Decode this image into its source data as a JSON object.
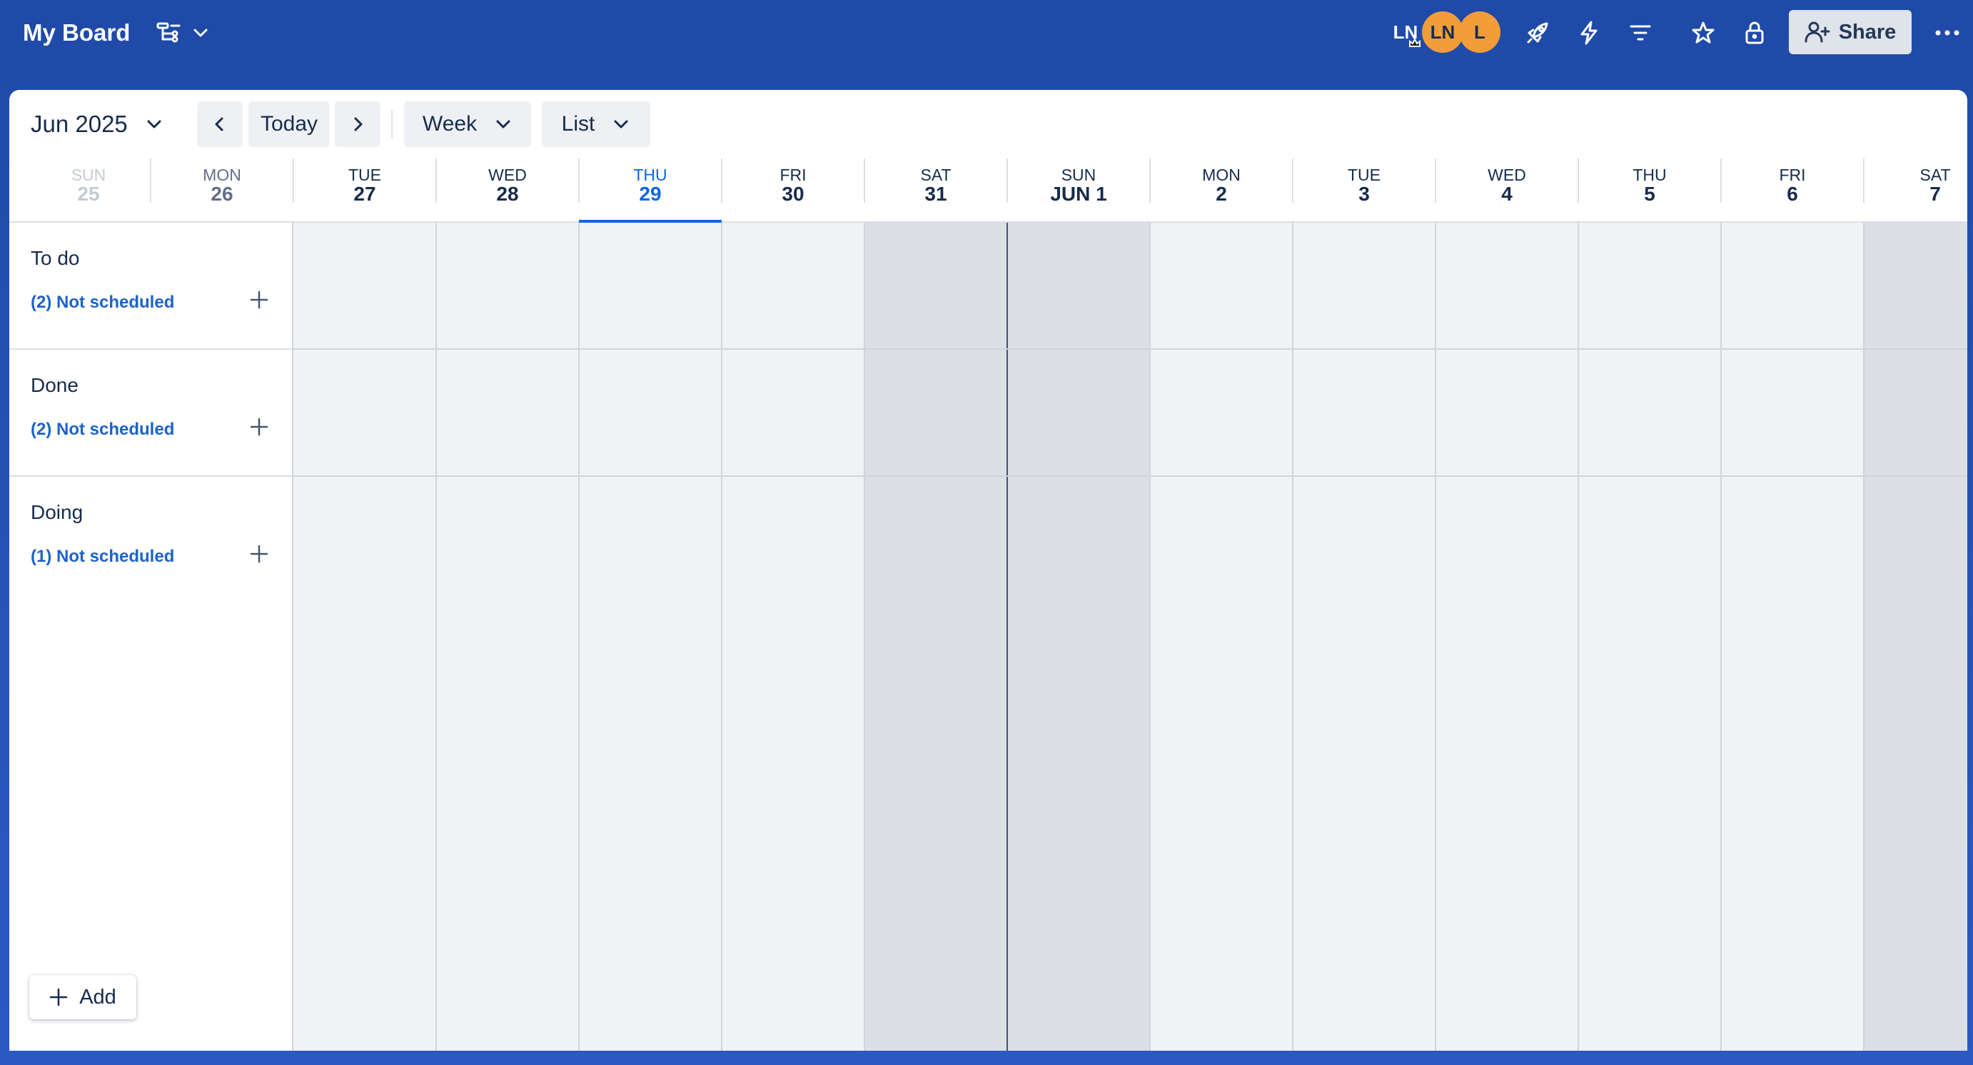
{
  "header": {
    "board_title": "My Board",
    "avatars": [
      {
        "initials": "LN",
        "bg": "#1d2125",
        "fg": "#ffffff"
      },
      {
        "initials": "LN",
        "bg": "#f29d39",
        "fg": "#172b4d"
      },
      {
        "initials": "L",
        "bg": "#f29d39",
        "fg": "#172b4d"
      }
    ],
    "share_label": "Share",
    "icons": [
      "view-switch-icon",
      "rocket-icon",
      "lightning-icon",
      "filter-icon",
      "star-icon",
      "lock-icon",
      "add-person-icon",
      "more-icon"
    ]
  },
  "toolbar": {
    "month": "Jun 2025",
    "today_label": "Today",
    "range_label": "Week",
    "view_label": "List"
  },
  "days": [
    {
      "name": "SUN",
      "num": "25",
      "state": "faded"
    },
    {
      "name": "MON",
      "num": "26",
      "state": "past"
    },
    {
      "name": "TUE",
      "num": "27",
      "state": ""
    },
    {
      "name": "WED",
      "num": "28",
      "state": ""
    },
    {
      "name": "THU",
      "num": "29",
      "state": "today"
    },
    {
      "name": "FRI",
      "num": "30",
      "state": ""
    },
    {
      "name": "SAT",
      "num": "31",
      "state": ""
    },
    {
      "name": "SUN",
      "num": "JUN 1",
      "state": ""
    },
    {
      "name": "MON",
      "num": "2",
      "state": ""
    },
    {
      "name": "TUE",
      "num": "3",
      "state": ""
    },
    {
      "name": "WED",
      "num": "4",
      "state": ""
    },
    {
      "name": "THU",
      "num": "5",
      "state": ""
    },
    {
      "name": "FRI",
      "num": "6",
      "state": ""
    },
    {
      "name": "SAT",
      "num": "7",
      "state": ""
    }
  ],
  "lists": [
    {
      "name": "To do",
      "unscheduled": "(2) Not scheduled"
    },
    {
      "name": "Done",
      "unscheduled": "(2) Not scheduled"
    },
    {
      "name": "Doing",
      "unscheduled": "(1) Not scheduled"
    }
  ],
  "add_label": "Add",
  "colors": {
    "accent": "#0c66e4",
    "link": "#1d62c9",
    "weekend_shade": "#dcdfe4",
    "grid_bg": "#f1f2f4"
  }
}
